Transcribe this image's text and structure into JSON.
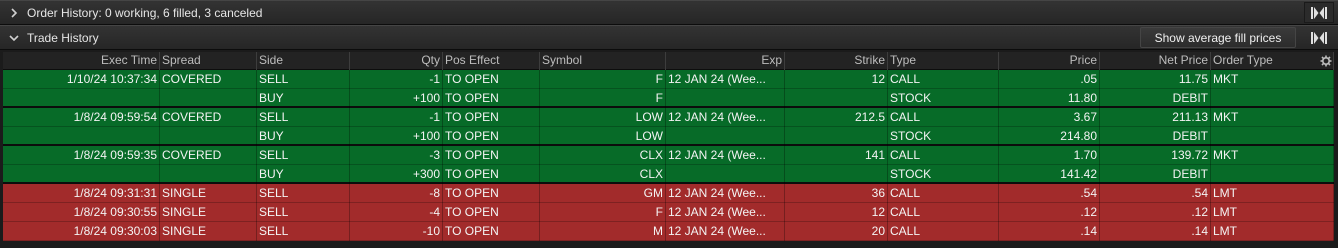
{
  "order_history": {
    "title": "Order History: 0 working, 6 filled, 3 canceled",
    "collapsed": true
  },
  "trade_history": {
    "title": "Trade History",
    "avg_fill_button": "Show average fill prices",
    "expanded": true
  },
  "colors": {
    "filled_row": "#076b28",
    "canceled_row": "#a22b2b",
    "header_bg": "#232323",
    "panel_bg": "#1b1b1b"
  },
  "columns": [
    "Exec Time",
    "Spread",
    "Side",
    "Qty",
    "Pos Effect",
    "Symbol",
    "Exp",
    "Strike",
    "Type",
    "Price",
    "Net Price",
    "Order Type"
  ],
  "rows": [
    {
      "status": "filled",
      "exec_time": "1/10/24 10:37:34",
      "spread": "COVERED",
      "side": "SELL",
      "qty": "-1",
      "pos_effect": "TO OPEN",
      "symbol": "F",
      "exp": "12 JAN 24 (Wee...",
      "strike": "12",
      "type": "CALL",
      "price": ".05",
      "net_price": "11.75",
      "order_type": "MKT"
    },
    {
      "status": "filled",
      "exec_time": "",
      "spread": "",
      "side": "BUY",
      "qty": "+100",
      "pos_effect": "TO OPEN",
      "symbol": "F",
      "exp": "",
      "strike": "",
      "type": "STOCK",
      "price": "11.80",
      "net_price": "DEBIT",
      "order_type": ""
    },
    {
      "status": "filled",
      "exec_time": "1/8/24 09:59:54",
      "spread": "COVERED",
      "side": "SELL",
      "qty": "-1",
      "pos_effect": "TO OPEN",
      "symbol": "LOW",
      "exp": "12 JAN 24 (Wee...",
      "strike": "212.5",
      "type": "CALL",
      "price": "3.67",
      "net_price": "211.13",
      "order_type": "MKT"
    },
    {
      "status": "filled",
      "exec_time": "",
      "spread": "",
      "side": "BUY",
      "qty": "+100",
      "pos_effect": "TO OPEN",
      "symbol": "LOW",
      "exp": "",
      "strike": "",
      "type": "STOCK",
      "price": "214.80",
      "net_price": "DEBIT",
      "order_type": ""
    },
    {
      "status": "filled",
      "exec_time": "1/8/24 09:59:35",
      "spread": "COVERED",
      "side": "SELL",
      "qty": "-3",
      "pos_effect": "TO OPEN",
      "symbol": "CLX",
      "exp": "12 JAN 24 (Wee...",
      "strike": "141",
      "type": "CALL",
      "price": "1.70",
      "net_price": "139.72",
      "order_type": "MKT"
    },
    {
      "status": "filled",
      "exec_time": "",
      "spread": "",
      "side": "BUY",
      "qty": "+300",
      "pos_effect": "TO OPEN",
      "symbol": "CLX",
      "exp": "",
      "strike": "",
      "type": "STOCK",
      "price": "141.42",
      "net_price": "DEBIT",
      "order_type": ""
    },
    {
      "status": "canceled",
      "exec_time": "1/8/24 09:31:31",
      "spread": "SINGLE",
      "side": "SELL",
      "qty": "-8",
      "pos_effect": "TO OPEN",
      "symbol": "GM",
      "exp": "12 JAN 24 (Wee...",
      "strike": "36",
      "type": "CALL",
      "price": ".54",
      "net_price": ".54",
      "order_type": "LMT"
    },
    {
      "status": "canceled",
      "exec_time": "1/8/24 09:30:55",
      "spread": "SINGLE",
      "side": "SELL",
      "qty": "-4",
      "pos_effect": "TO OPEN",
      "symbol": "F",
      "exp": "12 JAN 24 (Wee...",
      "strike": "12",
      "type": "CALL",
      "price": ".12",
      "net_price": ".12",
      "order_type": "LMT"
    },
    {
      "status": "canceled",
      "exec_time": "1/8/24 09:30:03",
      "spread": "SINGLE",
      "side": "SELL",
      "qty": "-10",
      "pos_effect": "TO OPEN",
      "symbol": "M",
      "exp": "12 JAN 24 (Wee...",
      "strike": "20",
      "type": "CALL",
      "price": ".14",
      "net_price": ".14",
      "order_type": "LMT"
    }
  ]
}
